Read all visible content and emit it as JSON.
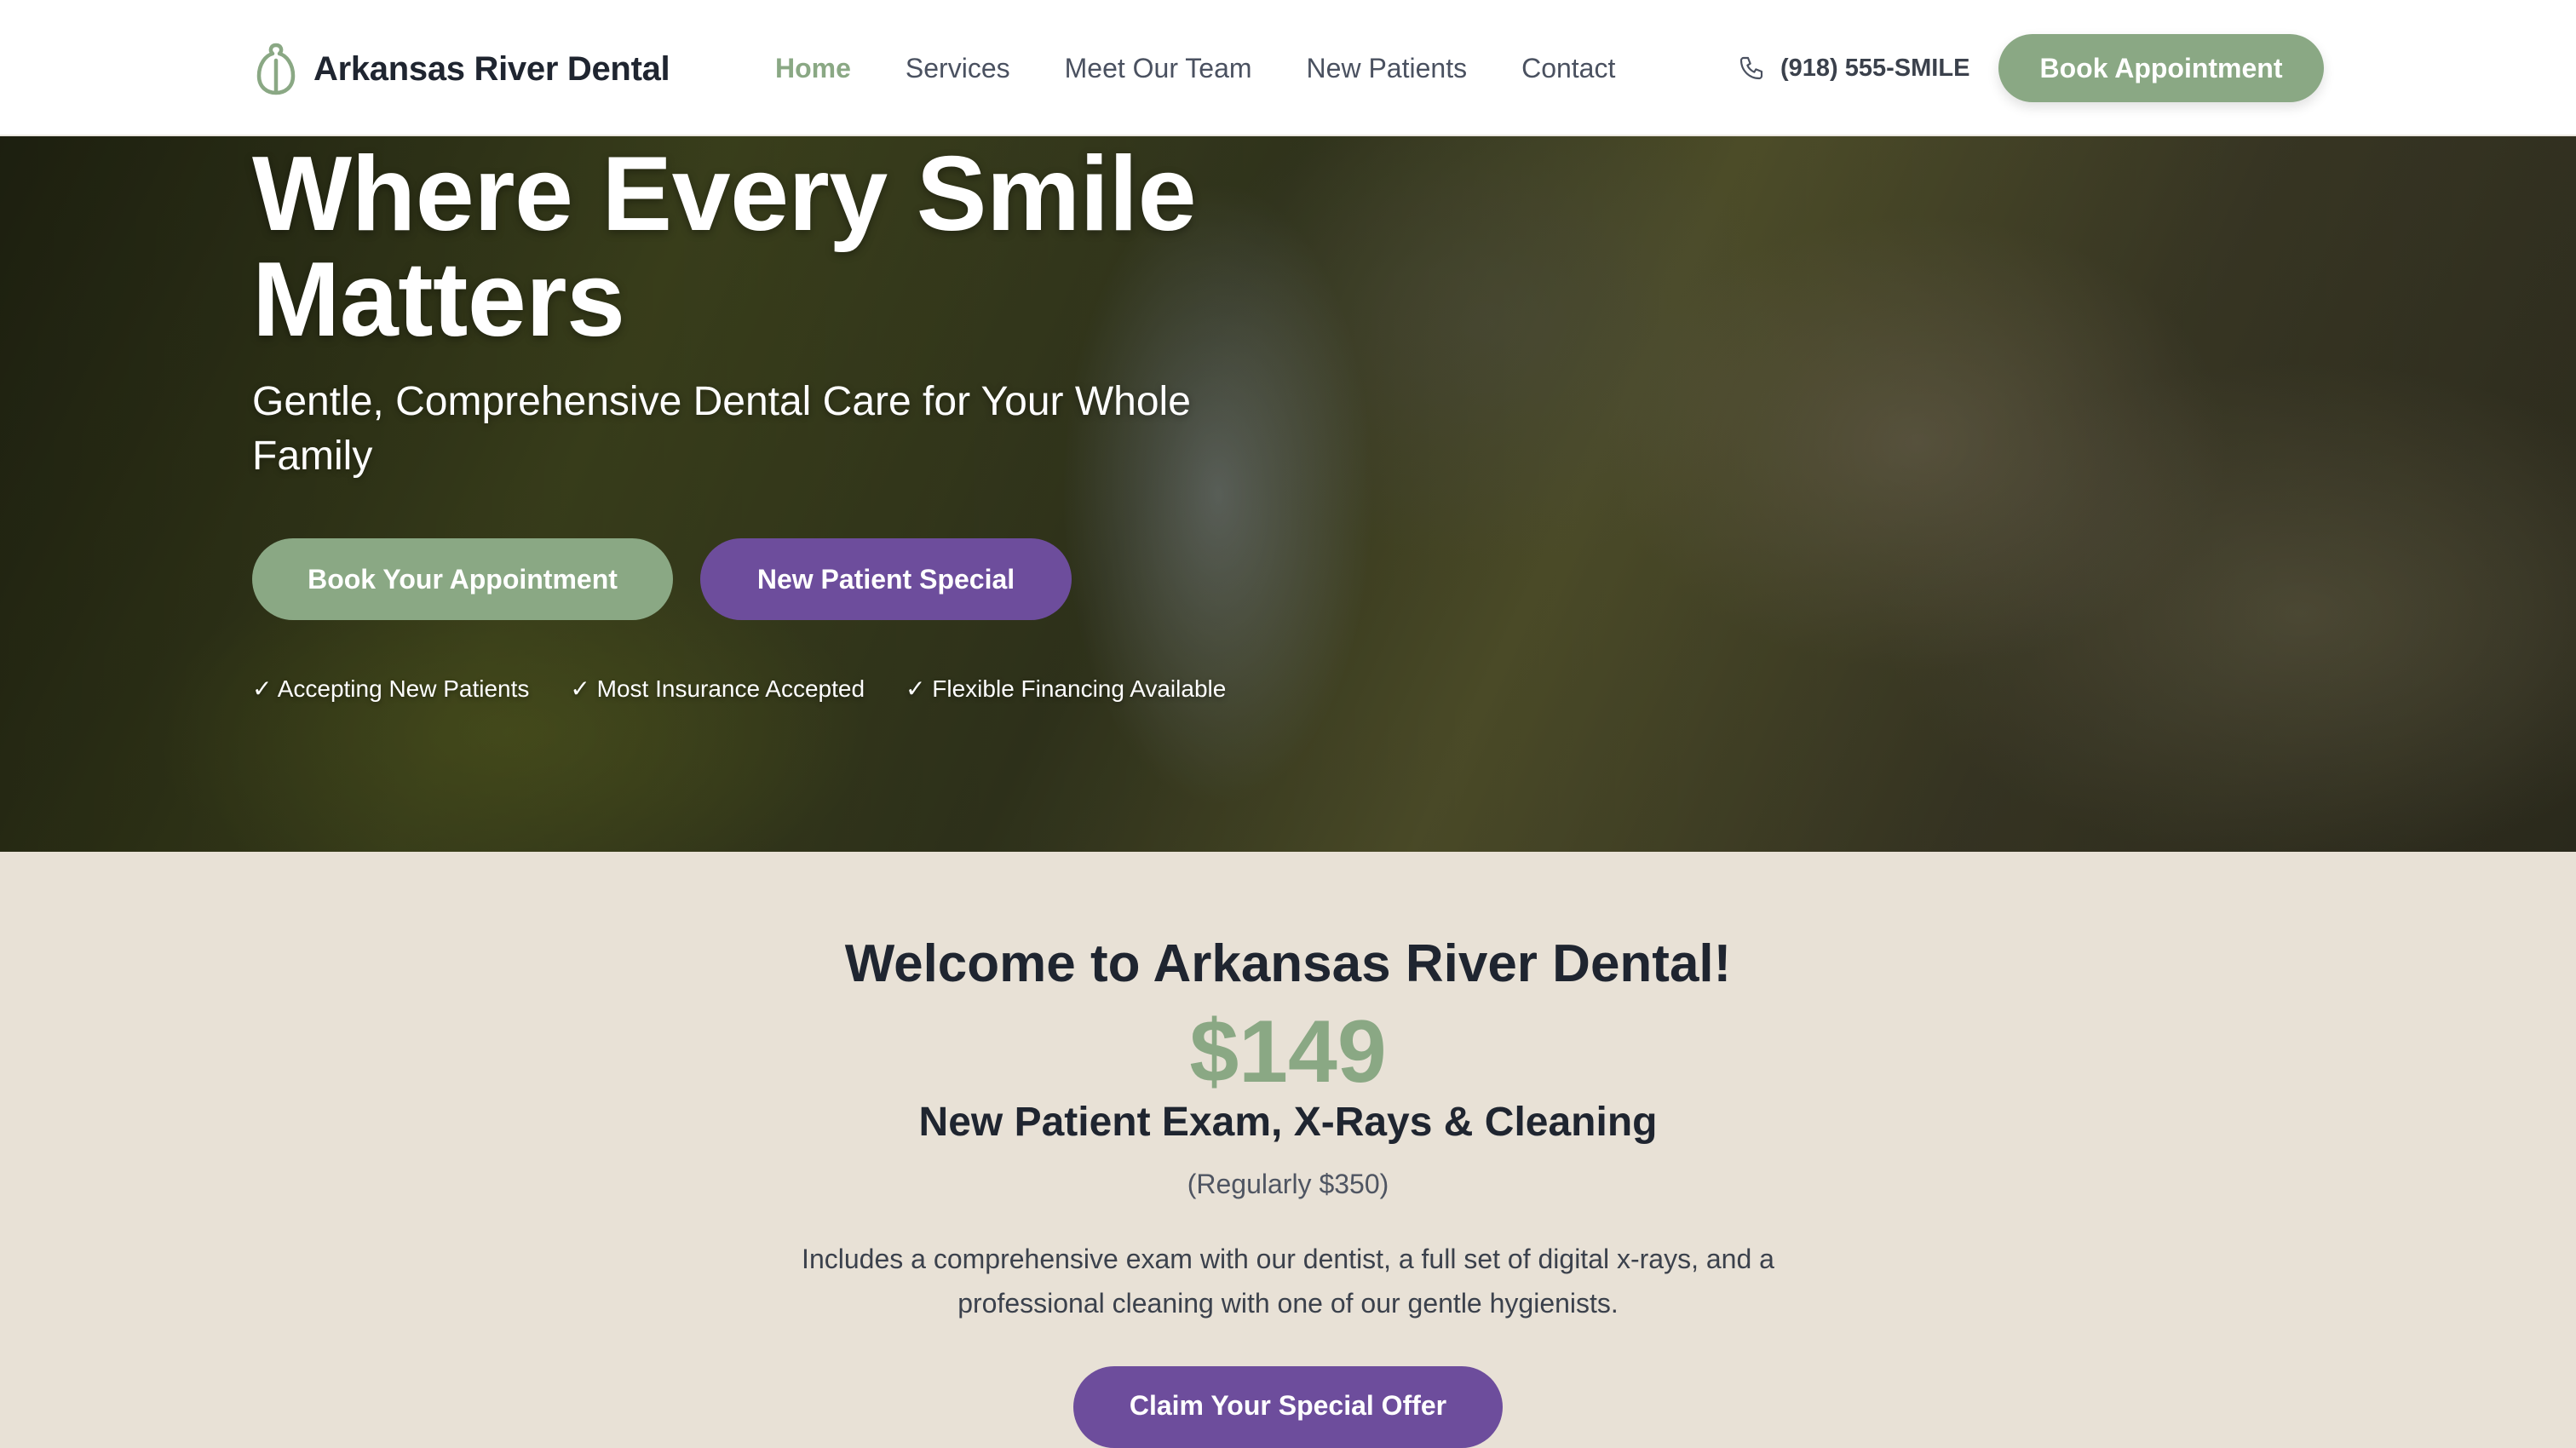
{
  "nav": {
    "brand": "Arkansas River Dental",
    "links": [
      {
        "label": "Home",
        "active": true
      },
      {
        "label": "Services"
      },
      {
        "label": "Meet Our Team"
      },
      {
        "label": "New Patients"
      },
      {
        "label": "Contact"
      }
    ],
    "phone": "(918) 555-SMILE",
    "cta": "Book Appointment"
  },
  "hero": {
    "title": "Where Every Smile Matters",
    "subtitle": "Gentle, Comprehensive Dental Care for Your Whole Family",
    "primary_button": "Book Your Appointment",
    "secondary_button": "New Patient Special",
    "checks": [
      "✓ Accepting New Patients",
      "✓ Most Insurance Accepted",
      "✓ Flexible Financing Available"
    ]
  },
  "welcome": {
    "title": "Welcome to Arkansas River Dental!",
    "price": "$149",
    "offer": "New Patient Exam, X-Rays & Cleaning",
    "regular": "(Regularly $350)",
    "description": "Includes a comprehensive exam with our dentist, a full set of digital x-rays, and a professional cleaning with one of our gentle hygienists.",
    "cta": "Claim Your Special Offer"
  },
  "icons": {
    "brand": "tooth-icon",
    "phone": "phone-icon"
  },
  "colors": {
    "accent_green": "#8aa884",
    "accent_purple": "#6d4d9c",
    "text_dark": "#1f2530",
    "section_bg": "#e8e1d6"
  }
}
